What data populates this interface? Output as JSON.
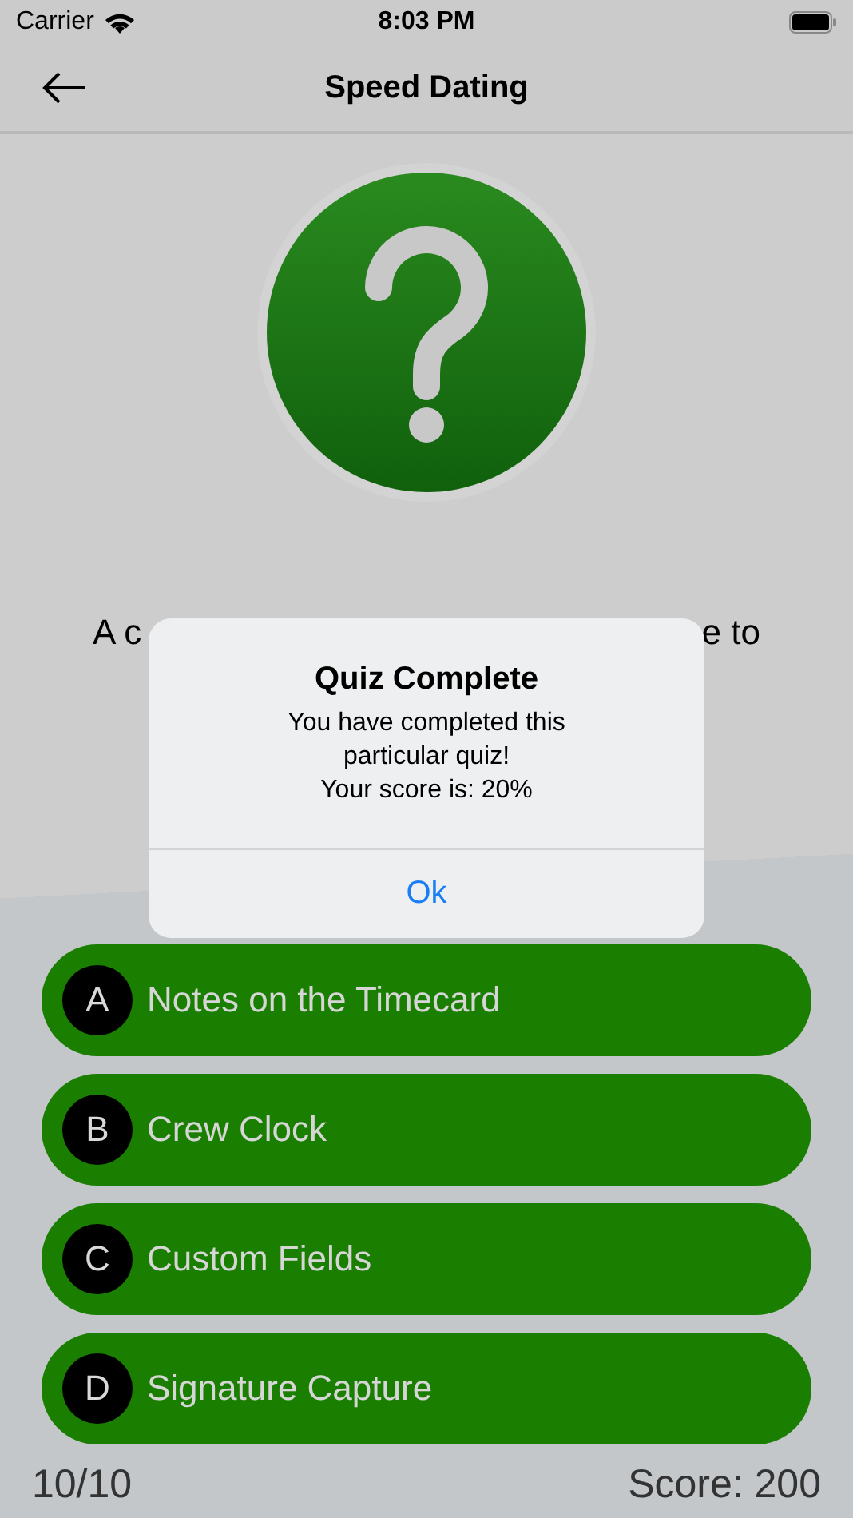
{
  "status_bar": {
    "carrier": "Carrier",
    "time": "8:03 PM"
  },
  "nav": {
    "title": "Speed Dating"
  },
  "question": {
    "visible_start": "A c",
    "visible_end": "e to"
  },
  "answers": [
    {
      "letter": "A",
      "text": "Notes on the Timecard"
    },
    {
      "letter": "B",
      "text": "Crew Clock"
    },
    {
      "letter": "C",
      "text": "Custom Fields"
    },
    {
      "letter": "D",
      "text": "Signature Capture"
    }
  ],
  "footer": {
    "progress": "10/10",
    "score": "Score: 200"
  },
  "dialog": {
    "title": "Quiz Complete",
    "message": "You have completed this\nparticular quiz!\nYour score is: 20%",
    "button": "Ok"
  }
}
